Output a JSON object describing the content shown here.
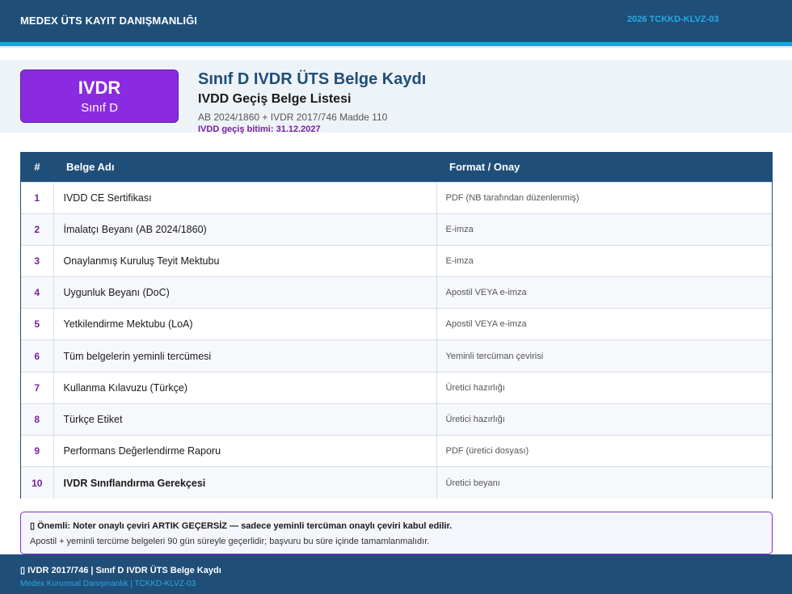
{
  "header": {
    "brand": "MEDEX ÜTS KAYIT DANIŞMANLIĞI",
    "code": "2026 TCKKD-KLVZ-03"
  },
  "hero": {
    "badge_line1": "IVDR",
    "badge_line2": "Sınıf D",
    "title": "Sınıf D IVDR ÜTS Belge Kaydı",
    "subtitle": "IVDD Geçiş Belge Listesi",
    "reference": "AB 2024/1860 + IVDR 2017/746 Madde 110",
    "deadline": "IVDD geçiş bitimi: 31.12.2027"
  },
  "table": {
    "headers": [
      "#",
      "Belge Adı",
      "Format / Onay"
    ],
    "rows": [
      {
        "no": "1",
        "name": "IVDD CE Sertifikası",
        "format": "PDF (NB tarafından düzenlenmiş)"
      },
      {
        "no": "2",
        "name": "İmalatçı Beyanı (AB 2024/1860)",
        "format": "E-imza"
      },
      {
        "no": "3",
        "name": "Onaylanmış Kuruluş Teyit Mektubu",
        "format": "E-imza"
      },
      {
        "no": "4",
        "name": "Uygunluk Beyanı (DoC)",
        "format": "Apostil VEYA e-imza"
      },
      {
        "no": "5",
        "name": "Yetkilendirme Mektubu (LoA)",
        "format": "Apostil VEYA e-imza"
      },
      {
        "no": "6",
        "name": "Tüm belgelerin yeminli tercümesi",
        "format": "Yeminli tercüman çevirisi"
      },
      {
        "no": "7",
        "name": "Kullanma Kılavuzu (Türkçe)",
        "format": "Üretici hazırlığı"
      },
      {
        "no": "8",
        "name": "Türkçe Etiket",
        "format": "Üretici hazırlığı"
      },
      {
        "no": "9",
        "name": "Performans Değerlendirme Raporu",
        "format": "PDF (üretici dosyası)"
      },
      {
        "no": "10",
        "name": "IVDR Sınıflandırma Gerekçesi",
        "format": "Üretici beyanı"
      }
    ]
  },
  "note": {
    "line1": "▯ Önemli: Noter onaylı çeviri ARTIK GEÇERSİZ — sadece yeminli tercüman onaylı çeviri kabul edilir.",
    "line2": "Apostil + yeminli tercüme belgeleri 90 gün süreyle geçerlidir; başvuru bu süre içinde tamamlanmalıdır."
  },
  "footer": {
    "line1": "▯ IVDR 2017/746  |  Sınıf D IVDR ÜTS Belge Kaydı",
    "line2": "Medex Kurumsal Danışmanlık  |  TCKKD-KLVZ-03"
  },
  "colors": {
    "primary": "#1f4e79",
    "accent": "#1aa5dc",
    "purple": "#8a2be2"
  }
}
